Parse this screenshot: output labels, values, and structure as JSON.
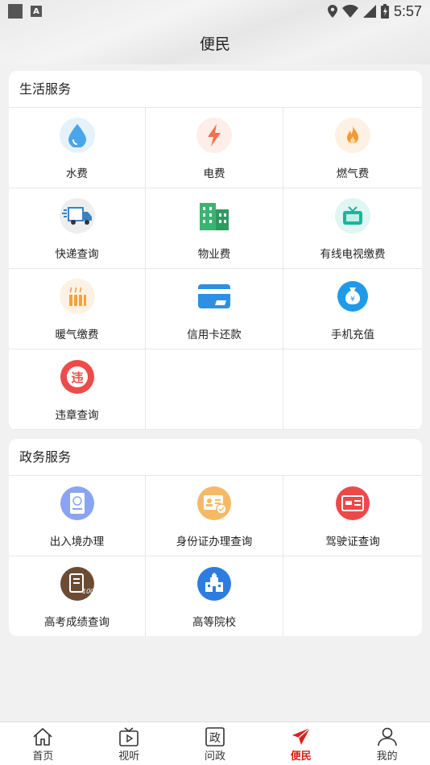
{
  "status_bar": {
    "time": "5:57"
  },
  "page": {
    "title": "便民"
  },
  "life_services": {
    "title": "生活服务",
    "items": [
      {
        "label": "水费",
        "icon": "water-drop-icon"
      },
      {
        "label": "电费",
        "icon": "lightning-icon"
      },
      {
        "label": "燃气费",
        "icon": "flame-icon"
      },
      {
        "label": "快递查询",
        "icon": "delivery-truck-icon"
      },
      {
        "label": "物业费",
        "icon": "building-icon"
      },
      {
        "label": "有线电视缴费",
        "icon": "tv-icon"
      },
      {
        "label": "暖气缴费",
        "icon": "heater-icon"
      },
      {
        "label": "信用卡还款",
        "icon": "credit-card-icon"
      },
      {
        "label": "手机充值",
        "icon": "money-bag-icon"
      },
      {
        "label": "违章查询",
        "icon": "violation-icon"
      }
    ]
  },
  "gov_services": {
    "title": "政务服务",
    "items": [
      {
        "label": "出入境办理",
        "icon": "passport-icon"
      },
      {
        "label": "身份证办理查询",
        "icon": "id-card-icon"
      },
      {
        "label": "驾驶证查询",
        "icon": "driver-license-icon"
      },
      {
        "label": "高考成绩查询",
        "icon": "exam-score-icon"
      },
      {
        "label": "高等院校",
        "icon": "university-icon"
      }
    ]
  },
  "bottom_nav": {
    "items": [
      {
        "label": "首页",
        "icon": "home-icon"
      },
      {
        "label": "视听",
        "icon": "video-icon"
      },
      {
        "label": "问政",
        "icon": "politics-icon"
      },
      {
        "label": "便民",
        "icon": "send-icon"
      },
      {
        "label": "我的",
        "icon": "person-icon"
      }
    ],
    "active_color": "#d9231d"
  }
}
